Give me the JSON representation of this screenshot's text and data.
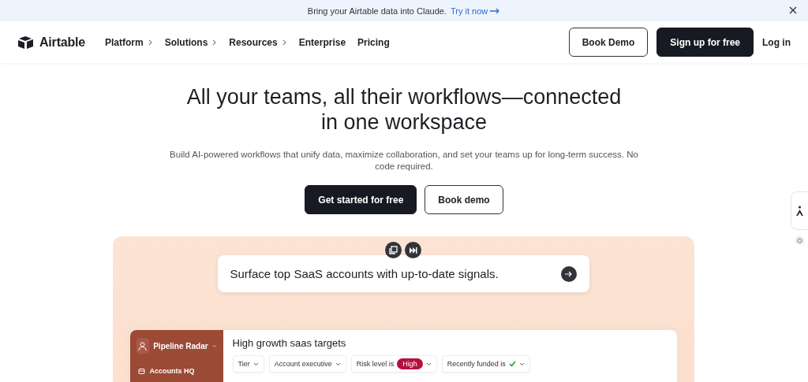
{
  "banner": {
    "text": "Bring your Airtable data into Claude.",
    "link": "Try it now"
  },
  "nav": {
    "logo": "Airtable",
    "items": [
      {
        "label": "Platform",
        "submenu": true
      },
      {
        "label": "Solutions",
        "submenu": true
      },
      {
        "label": "Resources",
        "submenu": true
      },
      {
        "label": "Enterprise",
        "submenu": false
      },
      {
        "label": "Pricing",
        "submenu": false
      }
    ],
    "buttons": [
      {
        "label": "Book Demo",
        "kind": "outline"
      },
      {
        "label": "Sign up for free",
        "kind": "primary"
      },
      {
        "label": "Log in",
        "kind": "text"
      }
    ]
  },
  "hero": {
    "title": "All your teams, all their workflows—connected in one workspace",
    "subtitle": "Build AI-powered workflows that unify data, maximize collaboration, and set your teams up for long-term success. No code required.",
    "buttons": [
      {
        "label": "Get started for free",
        "kind": "primary"
      },
      {
        "label": "Book demo",
        "kind": "outline"
      }
    ]
  },
  "prompt": {
    "text": "Surface top SaaS accounts with up-to-date signals."
  },
  "app": {
    "workspace": "Pipeline Radar",
    "sidebar_items": [
      "Accounts HQ"
    ],
    "view_title": "High growth saas targets",
    "filters": [
      {
        "kind": "plain",
        "label": "Tier"
      },
      {
        "kind": "plain",
        "label": "Account executive"
      },
      {
        "kind": "badge",
        "label": "Risk level is",
        "badge": "High"
      },
      {
        "kind": "check",
        "label": "Recently funded is"
      }
    ]
  }
}
